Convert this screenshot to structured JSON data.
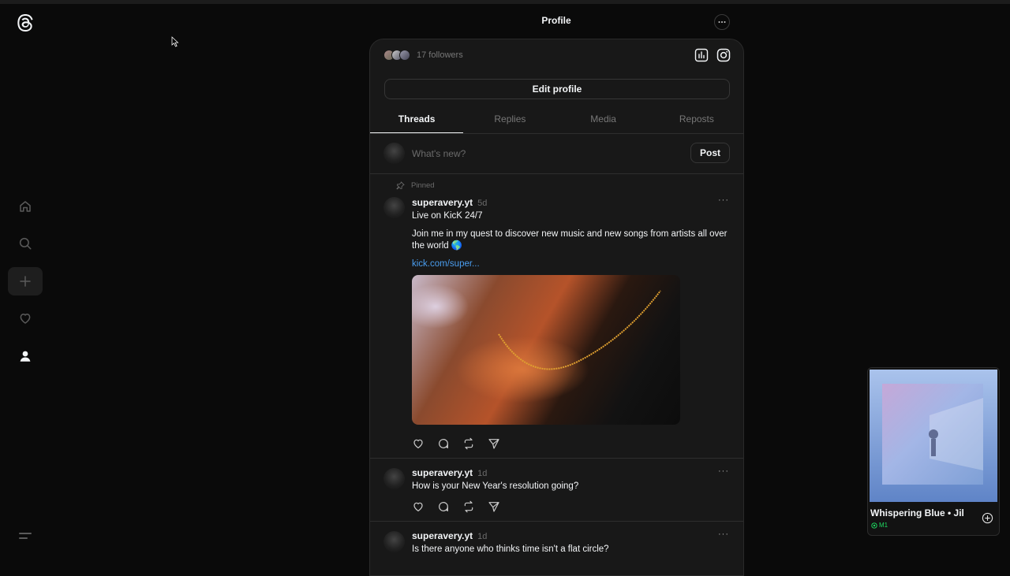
{
  "header": {
    "title": "Profile"
  },
  "profile": {
    "followers_text": "17 followers",
    "edit_label": "Edit profile",
    "tabs": [
      {
        "label": "Threads",
        "active": true
      },
      {
        "label": "Replies",
        "active": false
      },
      {
        "label": "Media",
        "active": false
      },
      {
        "label": "Reposts",
        "active": false
      }
    ]
  },
  "composer": {
    "placeholder": "What's new?",
    "post_label": "Post"
  },
  "threads": [
    {
      "pinned_label": "Pinned",
      "username": "superavery.yt",
      "time": "5d",
      "text": "Live on KicK 24/7",
      "body": "Join me in my quest to discover new music and new songs from artists all over the world 🌎",
      "link": "kick.com/super...",
      "has_image": true
    },
    {
      "username": "superavery.yt",
      "time": "1d",
      "text": "How is your New Year's resolution going?"
    },
    {
      "username": "superavery.yt",
      "time": "1d",
      "text": "Is there anyone who thinks time isn't a flat circle?"
    }
  ],
  "player": {
    "title": "Whispering Blue • Jil",
    "device": "M1"
  },
  "icons": [
    "threads-logo-icon",
    "home-icon",
    "search-icon",
    "create-icon",
    "heart-icon",
    "profile-icon",
    "menu-icon",
    "insights-icon",
    "instagram-icon",
    "more-icon",
    "pin-icon",
    "like-icon",
    "comment-icon",
    "repost-icon",
    "share-icon",
    "add-circle-icon",
    "device-icon"
  ],
  "colors": {
    "background": "#0a0a0a",
    "panel": "#181818",
    "link": "#4a9ef0",
    "spotify_green": "#1ed760"
  }
}
